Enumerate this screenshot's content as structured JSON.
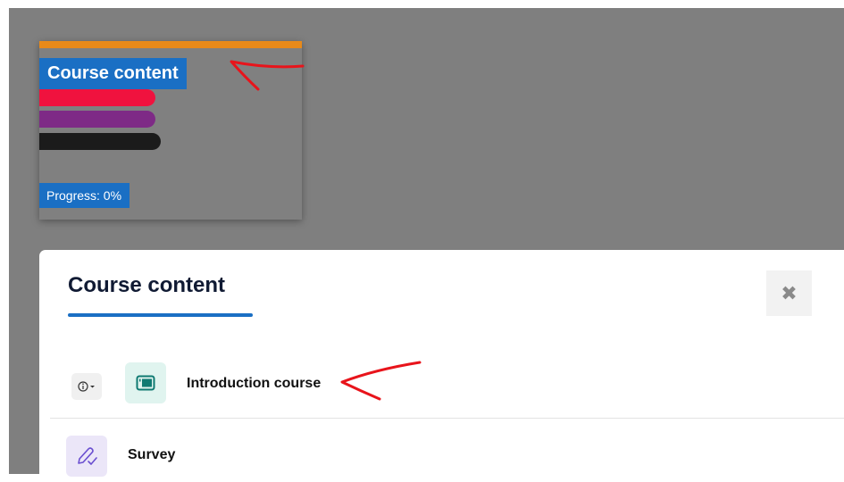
{
  "card": {
    "title": "Course content",
    "progress_label": "Progress: 0%"
  },
  "modal": {
    "title": "Course content",
    "close_icon": "close-icon",
    "items": [
      {
        "label": "Introduction course",
        "icon": "book-icon"
      },
      {
        "label": "Survey",
        "icon": "feedback-icon"
      }
    ]
  },
  "colors": {
    "overlay": "#7f7f7f",
    "accent": "#1a6fc4",
    "card_top": "#e88a1a",
    "annotation": "#e8141b"
  }
}
